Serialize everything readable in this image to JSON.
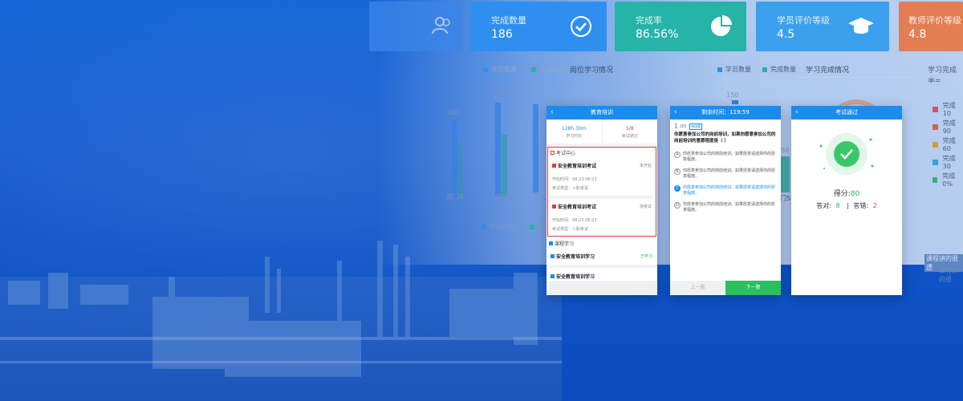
{
  "stats": [
    {
      "label": "完成数量",
      "value": "186",
      "color": "#2e8ff0",
      "icon": "check-circle-icon"
    },
    {
      "label": "完成率",
      "value": "86.56%",
      "color": "#26b3a8",
      "icon": "pie-chart-icon"
    },
    {
      "label": "学员评价等级",
      "value": "4.5",
      "color": "#3aa0ee",
      "icon": "graduation-cap-icon"
    },
    {
      "label": "教师评价等级",
      "value": "4.8",
      "color": "#e37d52",
      "icon": "teacher-icon"
    }
  ],
  "dashboard": {
    "legend_left": [
      "学员数量",
      "完成数量"
    ],
    "post_title": "岗位学习情况",
    "legend_mid": [
      "学员数量",
      "完成数量"
    ],
    "completion_title": "学习完成情况",
    "completion_rate_label": "学习完成率=",
    "axis_150_a": "150",
    "axis_100": "100",
    "axis_150_b": "150",
    "axis_150_c": "150",
    "axis_50": "50",
    "x_dept_a": "部门4",
    "x_dept_b": "部门4",
    "x_dept_c": "部门1",
    "x_dept_d": "门5",
    "x_dept_e": "门5",
    "legend_bottom": [
      "学员评价",
      "教师"
    ],
    "completion_legend": [
      "完成10",
      "完成90",
      "完成60",
      "完成30",
      "完成0%"
    ],
    "completion_colors": [
      "#c45a6b",
      "#c96b4a",
      "#c9a13a",
      "#3a9ee0",
      "#3aae72"
    ],
    "bottom_notes": [
      "课程讲的很透",
      "课程讲的很"
    ]
  },
  "phone1": {
    "title": "教育培训",
    "study_time": "128h 30m",
    "study_time_label": "学习时长",
    "exam_pass": "5/8",
    "exam_pass_label": "考试通过",
    "exam_center": "考试中心",
    "exams": [
      {
        "name": "安全教育培训考试",
        "status": "未开始",
        "time": "开始时间：08-23 08:23",
        "type": "考试类型：入职考试"
      },
      {
        "name": "安全教育培训考试",
        "status": "待考试",
        "time": "开始时间：08-23 08:23",
        "type": "考试类型：入职考试"
      }
    ],
    "course_section": "课程学习",
    "courses": [
      {
        "name": "安全教育培训学习",
        "status": "已学习"
      },
      {
        "name": "安全教育培训学习",
        "status": ""
      }
    ]
  },
  "phone2": {
    "title": "剩余时间：119:59",
    "progress_num": "1",
    "progress_total": "/20",
    "question_tag": "单选题",
    "question": "你愿意参加公司的岗前培训，如果你愿意参加公司的岗前培训的意愿程度是（    ）",
    "options": [
      {
        "key": "A",
        "text": "你愿意参加公司的岗前培训。如果愿意请选择你的愿意程度。"
      },
      {
        "key": "B",
        "text": "你愿意参加公司的岗前培训。如果愿意请选择你的愿意程度。"
      },
      {
        "key": "C",
        "text": "你愿意参加公司的岗前培训。如果愿意请选择你的愿意程度。"
      },
      {
        "key": "D",
        "text": "你愿意参加公司的岗前培训。如果愿意请选择你的愿意程度。"
      }
    ],
    "prev_label": "上一题",
    "next_label": "下一题"
  },
  "phone3": {
    "title": "考试通过",
    "score_label": "得分:",
    "score": "80",
    "correct_label": "答对:",
    "correct": "8",
    "wrong_label": "答错:",
    "wrong": "2",
    "separator": "|"
  }
}
